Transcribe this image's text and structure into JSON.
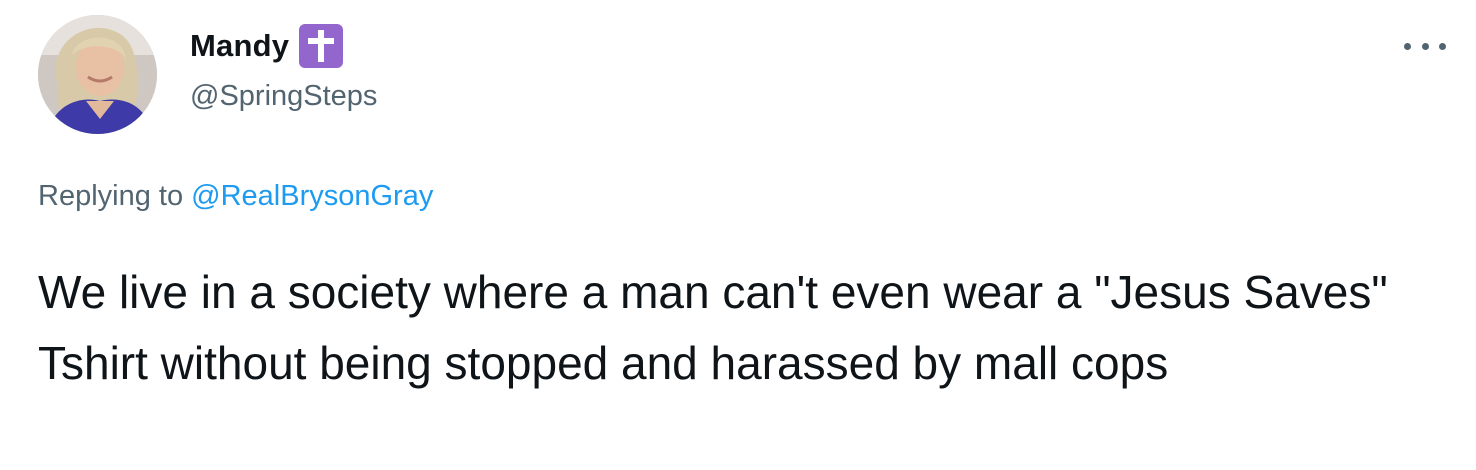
{
  "author": {
    "display_name": "Mandy",
    "emoji": "cross-emoji",
    "handle": "@SpringSteps"
  },
  "more_icon": "more-horizontal-icon",
  "reply": {
    "prefix": "Replying to",
    "mention": "@RealBrysonGray"
  },
  "tweet": {
    "text": "We live in a society where a man can't even wear a \"Jesus Saves\" Tshirt without being stopped and harassed by mall cops"
  },
  "colors": {
    "text": "#0f1419",
    "secondary": "#536471",
    "link": "#1d9bf0",
    "emoji_badge": "#9266cc"
  }
}
